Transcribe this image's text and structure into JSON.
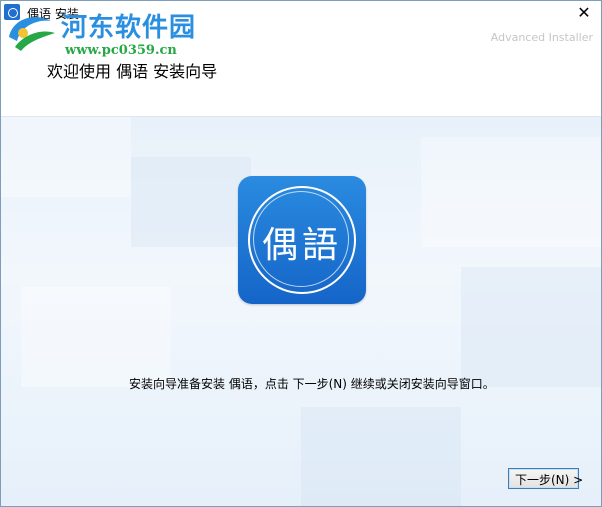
{
  "window": {
    "title": "偶语 安装",
    "close_glyph": "✕"
  },
  "watermark": {
    "site_name": "河东软件园",
    "url": "www.pc0359.cn"
  },
  "header": {
    "title": "欢迎使用 偶语 安装向导",
    "branding": "Advanced Installer"
  },
  "logo": {
    "characters": "偶語",
    "icon": "ouyu-app-logo"
  },
  "body": {
    "message": "安装向导准备安装 偶语，点击 下一步(N) 继续或关闭安装向导窗口。"
  },
  "buttons": {
    "next_label": "下一步(N) >"
  },
  "colors": {
    "accent": "#1e6fcf",
    "watermark_blue": "#2a8fe0",
    "watermark_green": "#26a846"
  }
}
